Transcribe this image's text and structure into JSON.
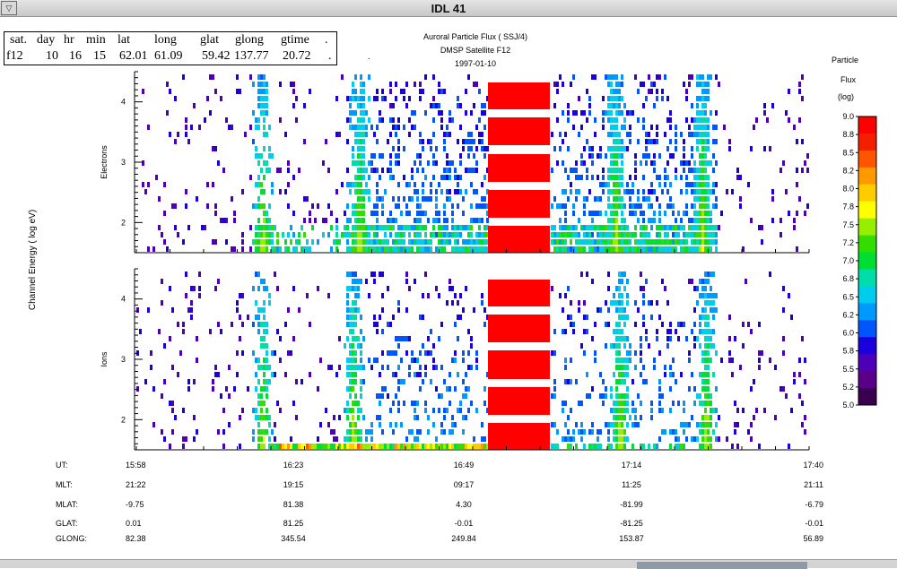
{
  "window": {
    "title": "IDL 41",
    "menu_glyph": "▽"
  },
  "info_table": {
    "headers": [
      "sat.",
      "day",
      "hr",
      "min",
      "lat",
      "long",
      "glat",
      "glong",
      "gtime",
      "."
    ],
    "values": [
      "f12",
      "10",
      "16",
      "15",
      "62.01",
      "61.09",
      "59.42",
      "137.77",
      "20.72",
      "."
    ]
  },
  "plot_title": {
    "line1": "Auroral Particle Flux ( SSJ/4)",
    "line2": "DMSP Satellite F12",
    "line3": "1997-01-10"
  },
  "dot_marker": ".",
  "y_axis_title": "Channel Energy ( log eV)",
  "panels": [
    {
      "label": "Electrons",
      "ticks": [
        "2",
        "3",
        "4"
      ]
    },
    {
      "label": "Ions",
      "ticks": [
        "2",
        "3",
        "4"
      ]
    }
  ],
  "colorbar": {
    "title_lines": [
      "Particle",
      "Flux",
      "(log)"
    ],
    "ticks": [
      "9.0",
      "8.8",
      "8.5",
      "8.2",
      "8.0",
      "7.8",
      "7.5",
      "7.2",
      "7.0",
      "6.8",
      "6.5",
      "6.2",
      "6.0",
      "5.8",
      "5.5",
      "5.2",
      "5.0"
    ],
    "colors": [
      "#ff0000",
      "#f41e00",
      "#ff5500",
      "#ff9900",
      "#ffcc00",
      "#ffff00",
      "#99ee00",
      "#33dd00",
      "#00dd33",
      "#00ddaa",
      "#00ccee",
      "#0099ff",
      "#0055ff",
      "#1a00dd",
      "#4d00b8",
      "#5a0088",
      "#3a0050"
    ]
  },
  "axis_table": {
    "rows": [
      {
        "label": "UT:",
        "values": [
          "15:58",
          "16:23",
          "16:49",
          "17:14",
          "17:40"
        ]
      },
      {
        "label": "MLT:",
        "values": [
          "21:22",
          "19:15",
          "09:17",
          "11:25",
          "21:11"
        ]
      },
      {
        "label": "MLAT:",
        "values": [
          "-9.75",
          "81.38",
          "4.30",
          "-81.99",
          "-6.79"
        ]
      },
      {
        "label": "GLAT:",
        "values": [
          "0.01",
          "81.25",
          "-0.01",
          "-81.25",
          "-0.01"
        ]
      },
      {
        "label": "GLONG:",
        "values": [
          "82.38",
          "345.54",
          "249.84",
          "153.87",
          "56.89"
        ]
      }
    ]
  },
  "colors": {
    "gap_fill": "#ff0000",
    "axes": "#000000",
    "background": "#ffffff"
  }
}
